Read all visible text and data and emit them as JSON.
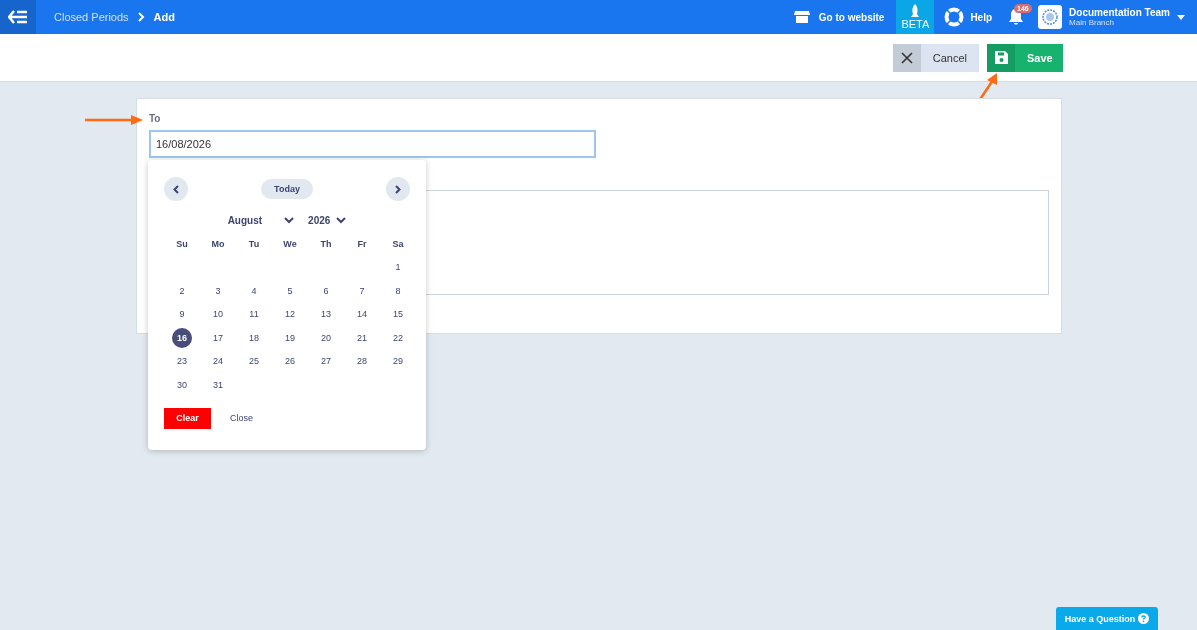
{
  "topbar": {
    "breadcrumb": [
      "Closed Periods",
      "Add"
    ],
    "website_link": "Go to website",
    "beta": "BETA",
    "help": "Help",
    "notifications": "146",
    "account": {
      "name": "Documentation Team",
      "branch": "Main Branch"
    }
  },
  "actions": {
    "cancel": "Cancel",
    "save": "Save"
  },
  "form": {
    "label": "To",
    "value": "16/08/2026"
  },
  "datepicker": {
    "today": "Today",
    "month": "August",
    "year": "2026",
    "weekdays": [
      "Su",
      "Mo",
      "Tu",
      "We",
      "Th",
      "Fr",
      "Sa"
    ],
    "weeks": [
      [
        {
          "label": "1",
          "selected": false
        }
      ],
      [
        {
          "label": "2",
          "selected": false
        },
        {
          "label": "3",
          "selected": false
        },
        {
          "label": "4",
          "selected": false
        },
        {
          "label": "5",
          "selected": false
        },
        {
          "label": "6",
          "selected": false
        },
        {
          "label": "7",
          "selected": false
        },
        {
          "label": "8",
          "selected": false
        }
      ],
      [
        {
          "label": "9",
          "selected": false
        },
        {
          "label": "10",
          "selected": false
        },
        {
          "label": "11",
          "selected": false
        },
        {
          "label": "12",
          "selected": false
        },
        {
          "label": "13",
          "selected": false
        },
        {
          "label": "14",
          "selected": false
        },
        {
          "label": "15",
          "selected": false
        }
      ],
      [
        {
          "label": "16",
          "selected": true
        },
        {
          "label": "17",
          "selected": false
        },
        {
          "label": "18",
          "selected": false
        },
        {
          "label": "19",
          "selected": false
        },
        {
          "label": "20",
          "selected": false
        },
        {
          "label": "21",
          "selected": false
        },
        {
          "label": "22",
          "selected": false
        }
      ],
      [
        {
          "label": "23",
          "selected": false
        },
        {
          "label": "24",
          "selected": false
        },
        {
          "label": "25",
          "selected": false
        },
        {
          "label": "26",
          "selected": false
        },
        {
          "label": "27",
          "selected": false
        },
        {
          "label": "28",
          "selected": false
        },
        {
          "label": "29",
          "selected": false
        }
      ],
      [
        {
          "label": "30",
          "selected": false
        },
        {
          "label": "31",
          "selected": false
        }
      ]
    ],
    "clear": "Clear",
    "close": "Close"
  },
  "help_widget": "Have a Question"
}
